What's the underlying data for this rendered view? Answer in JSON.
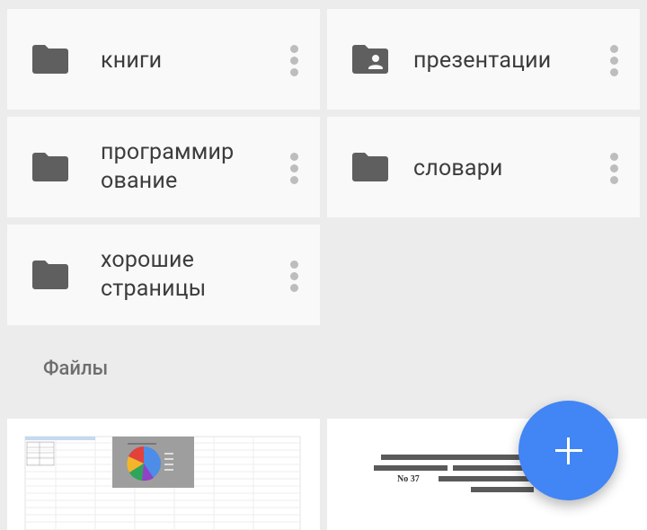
{
  "folders": [
    {
      "name": "книги",
      "icon": "folder-icon"
    },
    {
      "name": "презентации",
      "icon": "shared-folder-icon"
    },
    {
      "name": "программир\nование",
      "icon": "folder-icon"
    },
    {
      "name": "словари",
      "icon": "folder-icon"
    },
    {
      "name": "хорошие\nстраницы",
      "icon": "folder-icon"
    }
  ],
  "files_section": {
    "title": "Файлы"
  },
  "doc_preview": {
    "line3_label": "No 37"
  },
  "fab": {
    "icon": "plus-icon"
  },
  "colors": {
    "fab": "#4285f4",
    "icon": "#5f5f5f",
    "card": "#f9f9f9",
    "background": "#ececec"
  }
}
